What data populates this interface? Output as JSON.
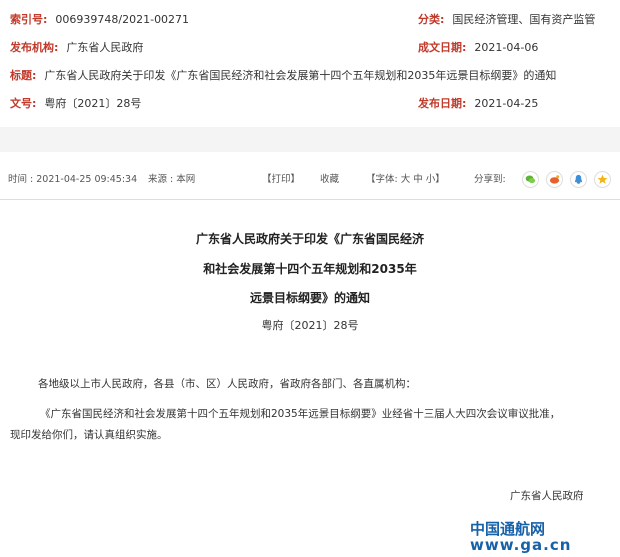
{
  "meta": {
    "index_label": "索引号:",
    "index_value": "006939748/2021-00271",
    "category_label": "分类:",
    "category_value": "国民经济管理、国有资产监管",
    "issuer_label": "发布机构:",
    "issuer_value": "广东省人民政府",
    "created_label": "成文日期:",
    "created_value": "2021-04-06",
    "title_label": "标题:",
    "title_value": "广东省人民政府关于印发《广东省国民经济和社会发展第十四个五年规划和2035年远景目标纲要》的通知",
    "docno_label": "文号:",
    "docno_value": "粤府〔2021〕28号",
    "published_label": "发布日期:",
    "published_value": "2021-04-25"
  },
  "info_bar": {
    "time": "时间 : 2021-04-25 09:45:34",
    "source": "来源 : 本网",
    "print": "【打印】",
    "favorite": "收藏",
    "font": "【字体: 大   中   小】",
    "share": "分享到:"
  },
  "share_icons": [
    "wechat-icon",
    "weibo-icon",
    "qq-zone-icon",
    "favorite-star-icon"
  ],
  "article": {
    "title_line1": "广东省人民政府关于印发《广东省国民经济",
    "title_line2": "和社会发展第十四个五年规划和2035年",
    "title_line3": "远景目标纲要》的通知",
    "doc_number": "粤府〔2021〕28号",
    "salutation": "各地级以上市人民政府，各县（市、区）人民政府，省政府各部门、各直属机构：",
    "paragraph_line1": "《广东省国民经济和社会发展第十四个五年规划和2035年远景目标纲要》业经省十三届人大四次会议审议批准，",
    "paragraph_line2": "现印发给你们，请认真组织实施。",
    "signature": "广东省人民政府"
  },
  "watermark": {
    "line1": "中国通航网",
    "line2": "www.ga.cn"
  },
  "colors": {
    "label_red": "#c0392b",
    "watermark_blue": "#1761a8"
  }
}
